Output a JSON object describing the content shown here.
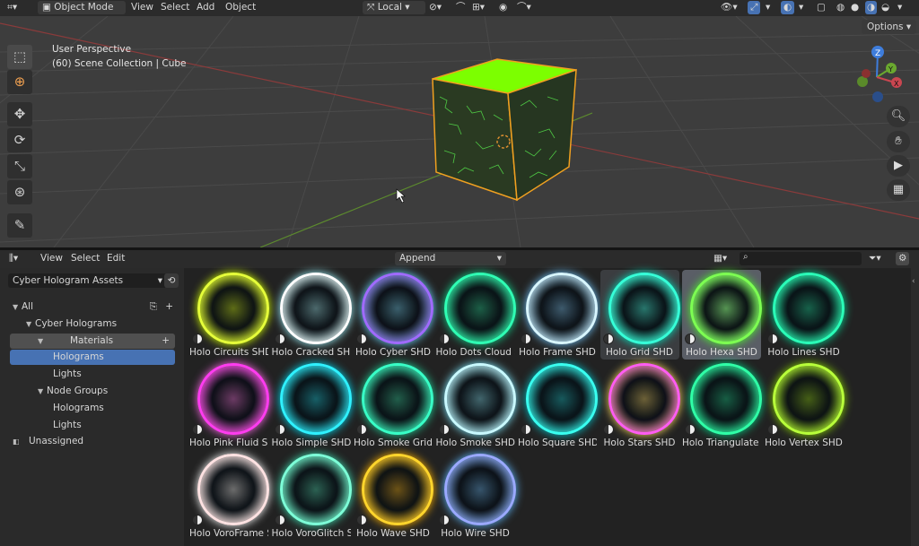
{
  "topbar": {
    "mode_label": "Object Mode",
    "menu": [
      "View",
      "Select",
      "Add",
      "Object"
    ],
    "pivot_label": "Local",
    "options_label": "Options"
  },
  "viewport": {
    "perspective_label": "User Perspective",
    "collection_label": "(60) Scene Collection | Cube",
    "axes": {
      "z": "Z",
      "y": "Y",
      "x": "X"
    }
  },
  "asset_browser": {
    "menu": [
      "View",
      "Select",
      "Edit"
    ],
    "import_mode": "Append",
    "search_placeholder": "",
    "library": "Cyber Hologram Assets",
    "tree": [
      {
        "label": "All",
        "level": 0,
        "expanded": true
      },
      {
        "label": "Cyber Holograms",
        "level": 1,
        "expanded": true
      },
      {
        "label": "Materials",
        "level": 2,
        "expanded": true
      },
      {
        "label": "Holograms",
        "level": 3,
        "selected": true
      },
      {
        "label": "Lights",
        "level": 3
      },
      {
        "label": "Node Groups",
        "level": 2,
        "expanded": true
      },
      {
        "label": "Holograms",
        "level": 3
      },
      {
        "label": "Lights",
        "level": 3
      },
      {
        "label": "Unassigned",
        "level": 0
      }
    ],
    "assets": [
      {
        "label": "Holo Circuits SHD",
        "color": "#e6ff3a",
        "glow": "#d4ff00"
      },
      {
        "label": "Holo Cracked SHD",
        "color": "#ffffff",
        "glow": "#9ff6ff"
      },
      {
        "label": "Holo Cyber SHD",
        "color": "#a06bff",
        "glow": "#6ad8ff"
      },
      {
        "label": "Holo Dots Cloud S...",
        "color": "#2fffb4",
        "glow": "#10d890"
      },
      {
        "label": "Holo Frame SHD",
        "color": "#d8f6ff",
        "glow": "#73c9ff"
      },
      {
        "label": "Holo Grid SHD",
        "color": "#36ffd8",
        "glow": "#00e5c2"
      },
      {
        "label": "Holo Hexa SHD",
        "color": "#7dff52",
        "glow": "#4bff2a"
      },
      {
        "label": "Holo Lines SHD",
        "color": "#2affb8",
        "glow": "#00e09b"
      },
      {
        "label": "Holo Pink Fluid SHD",
        "color": "#ff3cf0",
        "glow": "#ff6ae8"
      },
      {
        "label": "Holo Simple SHD",
        "color": "#2ff1ff",
        "glow": "#00d9ef"
      },
      {
        "label": "Holo Smoke Grid ...",
        "color": "#38ffc7",
        "glow": "#1fd69c"
      },
      {
        "label": "Holo Smoke SHD",
        "color": "#c9f9ff",
        "glow": "#7eeaff"
      },
      {
        "label": "Holo Square SHD",
        "color": "#39fff0",
        "glow": "#00c6cf"
      },
      {
        "label": "Holo Stars SHD",
        "color": "#ff5df2",
        "glow": "#ffdc61"
      },
      {
        "label": "Holo Triangulate S...",
        "color": "#2fffa7",
        "glow": "#00d487"
      },
      {
        "label": "Holo Vertex SHD",
        "color": "#b8ff3a",
        "glow": "#8bd800"
      },
      {
        "label": "Holo VoroFrame S...",
        "color": "#ffe2e2",
        "glow": "#ffffff"
      },
      {
        "label": "Holo VoroGlitch S...",
        "color": "#7dffd8",
        "glow": "#3fe0b4"
      },
      {
        "label": "Holo Wave SHD",
        "color": "#ffd52c",
        "glow": "#ffb300"
      },
      {
        "label": "Holo Wire SHD",
        "color": "#9aa9ff",
        "glow": "#5fb9ff"
      }
    ],
    "selected_asset": "Holo Hexa SHD",
    "hovered_asset": "Holo Grid SHD"
  },
  "colors": {
    "accent_selection": "#4772b3",
    "cube_top": "#7cff00",
    "cube_edge": "#f0a020"
  }
}
